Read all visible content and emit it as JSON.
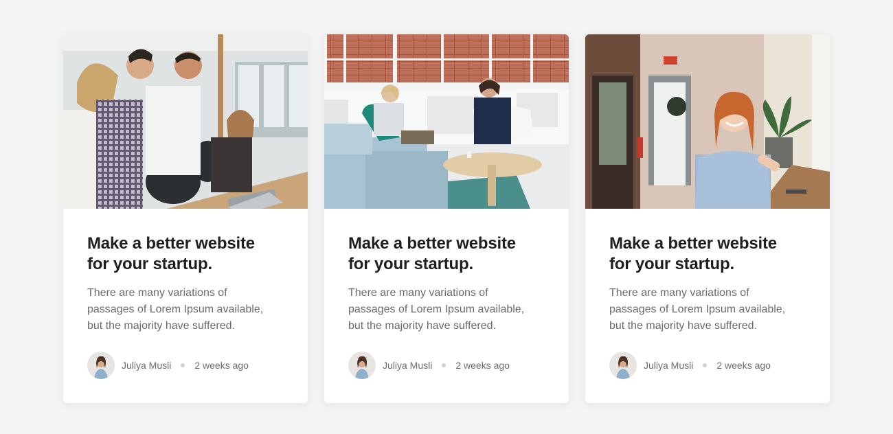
{
  "cards": [
    {
      "image_icon": "team-meeting-photo",
      "title_line1": "Make a better website",
      "title_line2": "for your startup.",
      "desc_line1": "There are many variations of",
      "desc_line2": "passages of Lorem Ipsum available,",
      "desc_line3": "but the majority have suffered.",
      "author": "Juliya Musli",
      "time": "2 weeks ago"
    },
    {
      "image_icon": "lounge-conversation-photo",
      "title_line1": "Make a better website",
      "title_line2": "for your startup.",
      "desc_line1": "There are many variations of",
      "desc_line2": "passages of Lorem Ipsum available,",
      "desc_line3": "but the majority have suffered.",
      "author": "Juliya Musli",
      "time": "2 weeks ago"
    },
    {
      "image_icon": "smiling-woman-hallway-photo",
      "title_line1": "Make a better website",
      "title_line2": "for your startup.",
      "desc_line1": "There are many variations of",
      "desc_line2": "passages of Lorem Ipsum available,",
      "desc_line3": "but the majority have suffered.",
      "author": "Juliya Musli",
      "time": "2 weeks ago"
    }
  ],
  "colors": {
    "page_background": "#f4f4f4",
    "card_background": "#ffffff",
    "title": "#1f1f1f",
    "body_text": "#6b6b6b"
  }
}
